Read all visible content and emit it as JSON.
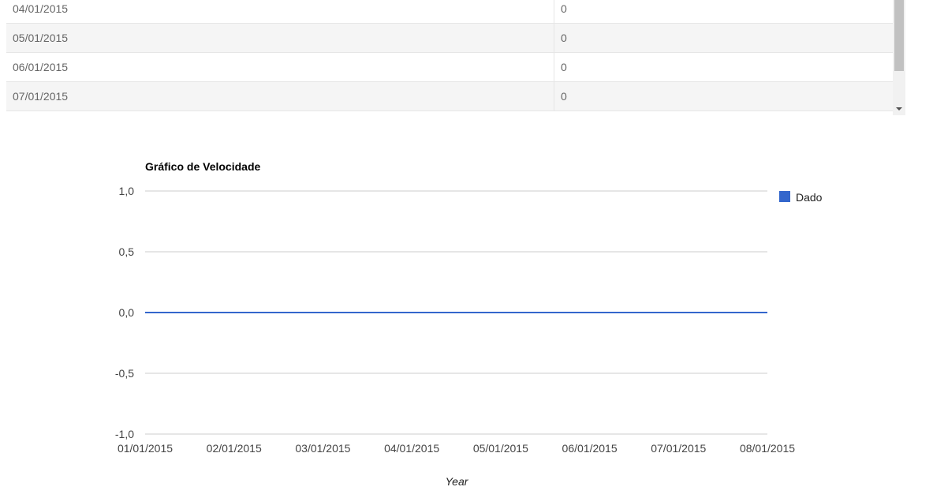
{
  "table": {
    "rows": [
      {
        "date": "04/01/2015",
        "value": "0"
      },
      {
        "date": "05/01/2015",
        "value": "0"
      },
      {
        "date": "06/01/2015",
        "value": "0"
      },
      {
        "date": "07/01/2015",
        "value": "0"
      }
    ]
  },
  "chart_data": {
    "type": "line",
    "title": "Gráfico de Velocidade",
    "xlabel": "Year",
    "ylabel": "",
    "x": [
      "01/01/2015",
      "02/01/2015",
      "03/01/2015",
      "04/01/2015",
      "05/01/2015",
      "06/01/2015",
      "07/01/2015",
      "08/01/2015"
    ],
    "series": [
      {
        "name": "Dado",
        "values": [
          0,
          0,
          0,
          0,
          0,
          0,
          0,
          0
        ],
        "color": "#3366cc"
      }
    ],
    "yticks": [
      {
        "value": 1.0,
        "label": "1,0"
      },
      {
        "value": 0.5,
        "label": "0,5"
      },
      {
        "value": 0.0,
        "label": "0,0"
      },
      {
        "value": -0.5,
        "label": "-0,5"
      },
      {
        "value": -1.0,
        "label": "-1,0"
      }
    ],
    "ylim": [
      -1,
      1
    ],
    "grid": true,
    "legend_position": "right"
  }
}
